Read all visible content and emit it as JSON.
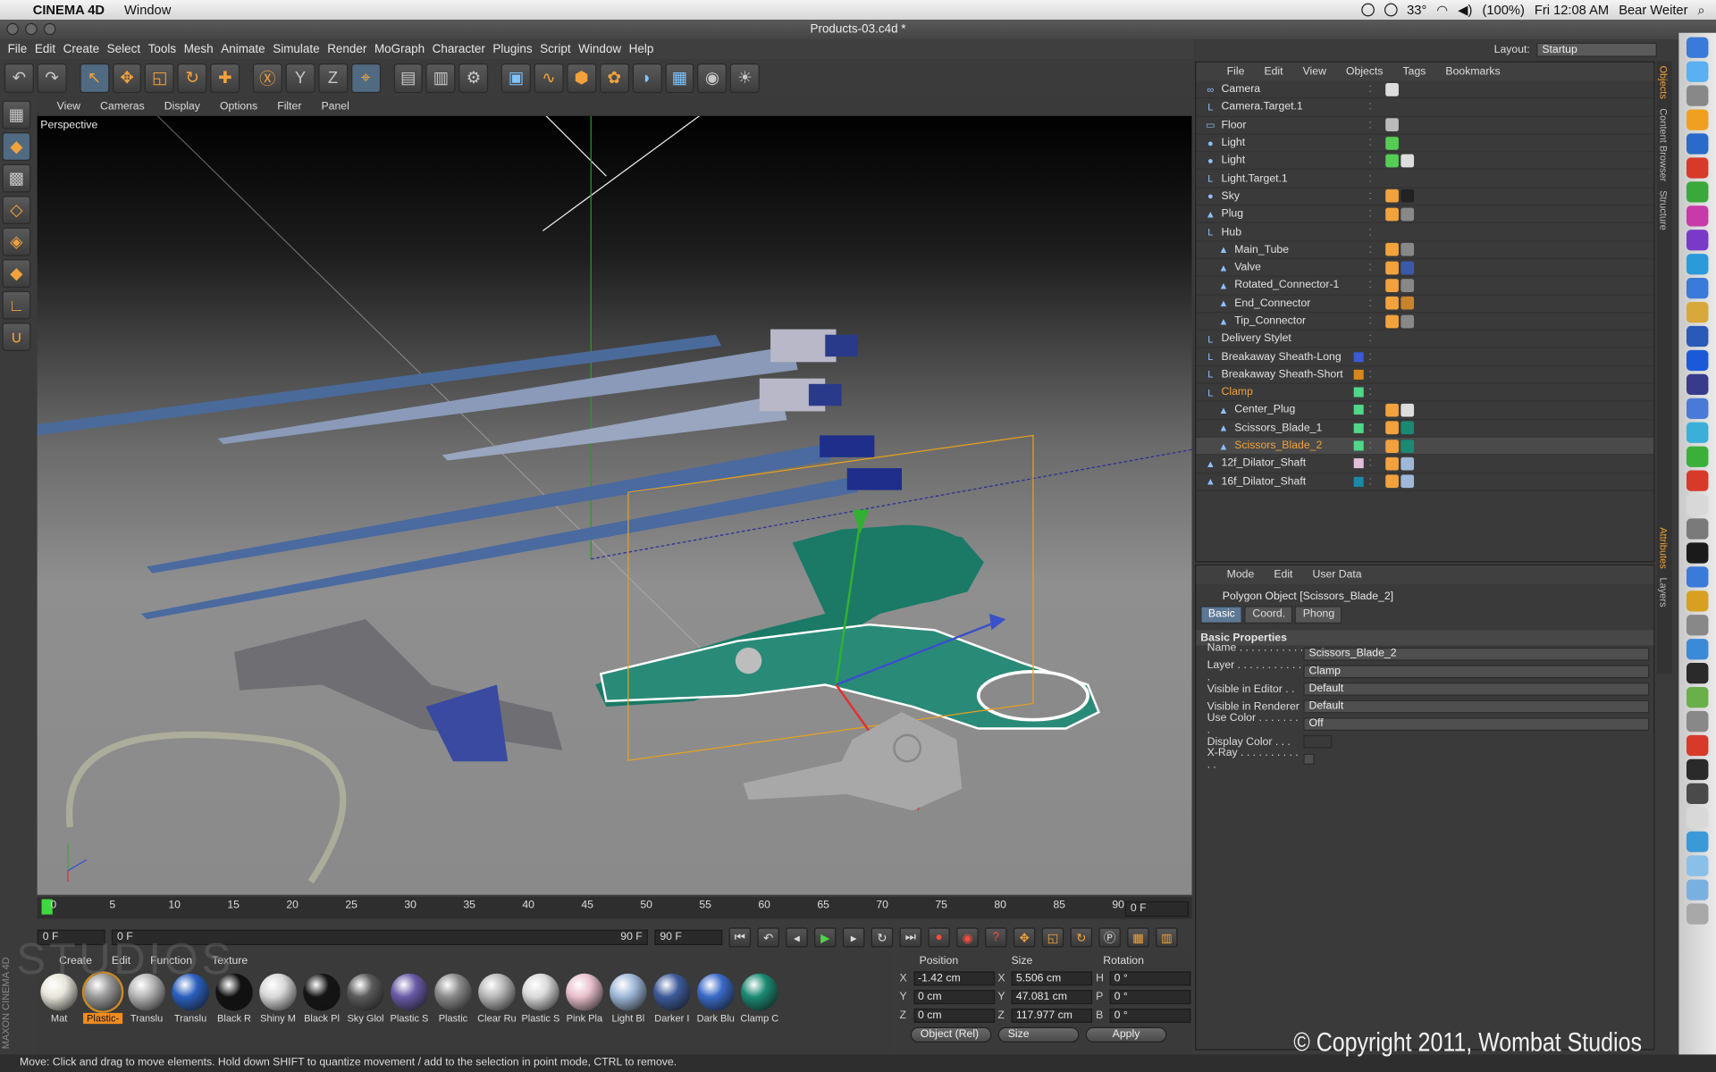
{
  "menubar": {
    "app": "CINEMA 4D",
    "window": "Window",
    "temp": "33°",
    "battery": "(100%)",
    "clock": "Fri 12:08 AM",
    "user": "Bear Weiter"
  },
  "title": "Products-03.c4d *",
  "appmenu": [
    "File",
    "Edit",
    "Create",
    "Select",
    "Tools",
    "Mesh",
    "Animate",
    "Simulate",
    "Render",
    "MoGraph",
    "Character",
    "Plugins",
    "Script",
    "Window",
    "Help"
  ],
  "layout": {
    "label": "Layout:",
    "value": "Startup"
  },
  "toolbar": {
    "axis_y": "Y",
    "axis_z": "Z"
  },
  "viewport": {
    "menu": [
      "View",
      "Cameras",
      "Display",
      "Options",
      "Filter",
      "Panel"
    ],
    "label": "Perspective"
  },
  "timeline": {
    "ticks": [
      "0",
      "5",
      "10",
      "15",
      "20",
      "25",
      "30",
      "35",
      "40",
      "45",
      "50",
      "55",
      "60",
      "65",
      "70",
      "75",
      "80",
      "85",
      "90"
    ],
    "current": "0 F",
    "start": "0 F",
    "range_start": "0 F",
    "range_end": "90 F",
    "end": "90 F"
  },
  "materials": {
    "menu": [
      "Create",
      "Edit",
      "Function",
      "Texture"
    ],
    "items": [
      {
        "name": "Mat",
        "color": "#e8e6dc"
      },
      {
        "name": "Plastic-",
        "color": "#9a9a9a",
        "selected": true
      },
      {
        "name": "Translu",
        "color": "#b5b5b5"
      },
      {
        "name": "Translu",
        "color": "#2a5fbf"
      },
      {
        "name": "Black R",
        "color": "#111111"
      },
      {
        "name": "Shiny M",
        "color": "#d8d8d8"
      },
      {
        "name": "Black Pl",
        "color": "#151515"
      },
      {
        "name": "Sky Glol",
        "color": "#5a5a5a"
      },
      {
        "name": "Plastic S",
        "color": "#6a5aa8"
      },
      {
        "name": "Plastic",
        "color": "#8a8a8a"
      },
      {
        "name": "Clear Ru",
        "color": "#b8b8b8"
      },
      {
        "name": "Plastic S",
        "color": "#dadada"
      },
      {
        "name": "Pink Pla",
        "color": "#e8c0cc"
      },
      {
        "name": "Light Bl",
        "color": "#9fb8d8"
      },
      {
        "name": "Darker I",
        "color": "#3d5a9a"
      },
      {
        "name": "Dark Blu",
        "color": "#3a6ac8"
      },
      {
        "name": "Clamp C",
        "color": "#1a8a72"
      }
    ]
  },
  "coords": {
    "headers": [
      "Position",
      "Size",
      "Rotation"
    ],
    "rows": [
      {
        "axis": "X",
        "pos": "-1.42 cm",
        "saxis": "X",
        "size": "5.506 cm",
        "raxis": "H",
        "rot": "0 °"
      },
      {
        "axis": "Y",
        "pos": "0 cm",
        "saxis": "Y",
        "size": "47.081 cm",
        "raxis": "P",
        "rot": "0 °"
      },
      {
        "axis": "Z",
        "pos": "0 cm",
        "saxis": "Z",
        "size": "117.977 cm",
        "raxis": "B",
        "rot": "0 °"
      }
    ],
    "mode": "Object (Rel)",
    "size_mode": "Size",
    "apply": "Apply"
  },
  "status": "Move: Click and drag to move elements. Hold down SHIFT to quantize movement / add to the selection in point mode, CTRL to remove.",
  "copyright": "© Copyright 2011, Wombat Studios",
  "watermark": "STUDIOS",
  "brand": "MAXON CINEMA 4D",
  "objects": {
    "menu": [
      "File",
      "Edit",
      "View",
      "Objects",
      "Tags",
      "Bookmarks"
    ],
    "rows": [
      {
        "name": "Camera",
        "indent": 0,
        "icon": "∞",
        "tags": [
          "#ddd"
        ]
      },
      {
        "name": "Camera.Target.1",
        "indent": 0,
        "icon": "L"
      },
      {
        "name": "Floor",
        "indent": 0,
        "icon": "▭",
        "tags": [
          "#bbb"
        ]
      },
      {
        "name": "Light",
        "indent": 0,
        "icon": "●",
        "tags": [
          "#5c5"
        ]
      },
      {
        "name": "Light",
        "indent": 0,
        "icon": "●",
        "tags": [
          "#5c5",
          "#ddd"
        ]
      },
      {
        "name": "Light.Target.1",
        "indent": 0,
        "icon": "L"
      },
      {
        "name": "Sky",
        "indent": 0,
        "icon": "●",
        "tags": [
          "#f2a23c",
          "#222"
        ]
      },
      {
        "name": "Plug",
        "indent": 0,
        "icon": "▲",
        "tags": [
          "#f2a23c",
          "#888"
        ]
      },
      {
        "name": "Hub",
        "indent": 0,
        "icon": "L"
      },
      {
        "name": "Main_Tube",
        "indent": 1,
        "icon": "▲",
        "tags": [
          "#f2a23c",
          "#888"
        ]
      },
      {
        "name": "Valve",
        "indent": 1,
        "icon": "▲",
        "tags": [
          "#f2a23c",
          "#3a5aa8"
        ]
      },
      {
        "name": "Rotated_Connector-1",
        "indent": 1,
        "icon": "▲",
        "tags": [
          "#f2a23c",
          "#888"
        ]
      },
      {
        "name": "End_Connector",
        "indent": 1,
        "icon": "▲",
        "tags": [
          "#f2a23c",
          "#c8842c"
        ]
      },
      {
        "name": "Tip_Connector",
        "indent": 1,
        "icon": "▲",
        "tags": [
          "#f2a23c",
          "#888"
        ]
      },
      {
        "name": "Delivery Stylet",
        "indent": 0,
        "icon": "L"
      },
      {
        "name": "Breakaway Sheath-Long",
        "indent": 0,
        "icon": "L",
        "chip": "#3a5ad8"
      },
      {
        "name": "Breakaway Sheath-Short",
        "indent": 0,
        "icon": "L",
        "chip": "#d8881a"
      },
      {
        "name": "Clamp",
        "indent": 0,
        "icon": "L",
        "chip": "#4fd88a",
        "hl": true
      },
      {
        "name": "Center_Plug",
        "indent": 1,
        "icon": "▲",
        "chip": "#4fd88a",
        "tags": [
          "#f2a23c",
          "#ddd"
        ]
      },
      {
        "name": "Scissors_Blade_1",
        "indent": 1,
        "icon": "▲",
        "chip": "#4fd88a",
        "tags": [
          "#f2a23c",
          "#1a8a72"
        ]
      },
      {
        "name": "Scissors_Blade_2",
        "indent": 1,
        "icon": "▲",
        "chip": "#4fd88a",
        "tags": [
          "#f2a23c",
          "#1a8a72"
        ],
        "sel": true
      },
      {
        "name": "12f_Dilator_Shaft",
        "indent": 0,
        "icon": "▲",
        "chip": "#e0c0d8",
        "tags": [
          "#f2a23c",
          "#9fb8d8"
        ]
      },
      {
        "name": "16f_Dilator_Shaft",
        "indent": 0,
        "icon": "▲",
        "chip": "#1a8aa8",
        "tags": [
          "#f2a23c",
          "#9fb8d8"
        ]
      }
    ]
  },
  "attributes": {
    "menu": [
      "Mode",
      "Edit",
      "User Data"
    ],
    "title": "Polygon Object [Scissors_Blade_2]",
    "tabs": [
      "Basic",
      "Coord.",
      "Phong"
    ],
    "section": "Basic Properties",
    "rows": [
      {
        "label": "Name . . . . . . . . . . . .",
        "value": "Scissors_Blade_2"
      },
      {
        "label": "Layer . . . . . . . . . . . .",
        "value": "Clamp"
      },
      {
        "label": "Visible in Editor . .",
        "value": "Default"
      },
      {
        "label": "Visible in Renderer",
        "value": "Default"
      },
      {
        "label": "Use Color . . . . . . . .",
        "value": "Off"
      },
      {
        "label": "Display Color . . .",
        "value": ""
      },
      {
        "label": "X-Ray . . . . . . . . . . . .",
        "value": ""
      }
    ]
  },
  "sidetabs": [
    "Objects",
    "Content Browser",
    "Structure"
  ],
  "sidetabs2": [
    "Attributes",
    "Layers"
  ]
}
